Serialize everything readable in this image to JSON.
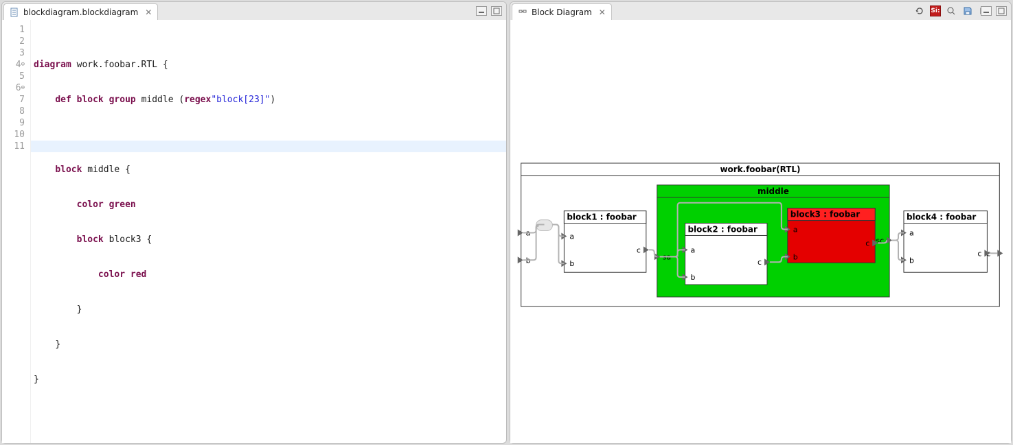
{
  "left": {
    "tab_title": "blockdiagram.blockdiagram",
    "code": {
      "kw_diagram": "diagram",
      "diag_name": "work.foobar.RTL",
      "brace_open": "{",
      "kw_def": "def",
      "kw_block1": "block",
      "kw_group": "group",
      "group_name": "middle",
      "paren_open": "(",
      "kw_regex": "regex",
      "regex_str": "\"block[23]\"",
      "paren_close": ")",
      "kw_block2": "block",
      "block2_name": "middle",
      "brace_open2": "{",
      "kw_color1": "color",
      "color1_val": "green",
      "kw_block3": "block",
      "block3_name": "block3",
      "brace_open3": "{",
      "kw_color2": "color",
      "color2_val": "red",
      "brace_close3": "}",
      "brace_close2": "}",
      "brace_close1": "}",
      "line_numbers": [
        "1",
        "2",
        "3",
        "4",
        "5",
        "6",
        "7",
        "8",
        "9",
        "10",
        "11"
      ]
    }
  },
  "right": {
    "tab_title": "Block Diagram",
    "si_label": "Si:",
    "diagram": {
      "outer_title": "work.foobar(RTL)",
      "middle_title": "middle",
      "port_a": "a",
      "port_b": "b",
      "port_c": "c",
      "port_sa": "sa",
      "port_sc": "sc",
      "block1_name": "block1 : foobar",
      "block2_name": "block2 : foobar",
      "block3_name": "block3 : foobar",
      "block4_name": "block4 : foobar"
    }
  }
}
